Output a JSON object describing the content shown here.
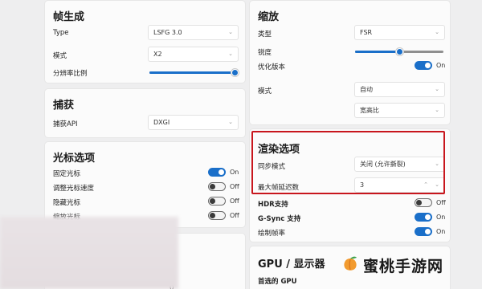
{
  "frame_gen": {
    "title": "帧生成",
    "type_label": "Type",
    "type_value": "LSFG 3.0",
    "mode_label": "模式",
    "mode_value": "X2",
    "resolution_label": "分辨率比例",
    "resolution_level": 1.0
  },
  "capture": {
    "title": "捕获",
    "api_label": "捕获API",
    "api_value": "DXGI"
  },
  "cursor": {
    "title": "光标选项",
    "items": [
      {
        "label": "固定光标",
        "state": "On",
        "on": true
      },
      {
        "label": "调整光标速度",
        "state": "Off",
        "on": false
      },
      {
        "label": "隐藏光标",
        "state": "Off",
        "on": false
      },
      {
        "label": "缩放光标",
        "state": "Off",
        "on": false
      }
    ]
  },
  "scaling": {
    "title": "缩放",
    "type_label": "类型",
    "type_value": "FSR",
    "sharpness_label": "锐度",
    "sharpness_level": 0.45,
    "optimized_label": "优化版本",
    "optimized_state": "On",
    "mode_label": "模式",
    "mode_value": "自动",
    "aspect_value": "宽高比"
  },
  "render": {
    "title": "渲染选项",
    "sync_label": "同步模式",
    "sync_value": "关闭 (允许撕裂)",
    "max_frames_label": "最大帧延迟数",
    "max_frames_value": "3",
    "hdr_label": "HDR支持",
    "hdr_state": "Off",
    "gsync_label": "G-Sync 支持",
    "gsync_state": "On",
    "draw_fps_label": "绘制帧率",
    "draw_fps_state": "On"
  },
  "gpu": {
    "title": "GPU / 显示器",
    "preferred_label": "首选的 GPU"
  },
  "bottom_left_digit": "0",
  "watermark_text": "蜜桃手游网",
  "colors": {
    "accent": "#1a6fc9",
    "highlight_border": "#c8161d"
  }
}
